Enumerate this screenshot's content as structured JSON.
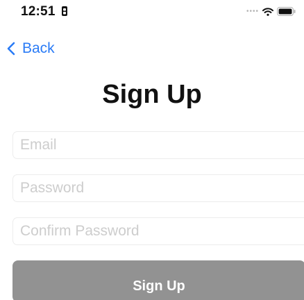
{
  "status_bar": {
    "time": "12:51",
    "icons": [
      "more-dots-icon",
      "wifi-icon",
      "battery-icon"
    ]
  },
  "nav": {
    "back_label": "Back",
    "back_icon": "chevron-left-icon",
    "accent_color": "#2a7bf6"
  },
  "page": {
    "title": "Sign Up"
  },
  "form": {
    "email": {
      "value": "",
      "placeholder": "Email"
    },
    "password": {
      "value": "",
      "placeholder": "Password"
    },
    "confirm_password": {
      "value": "",
      "placeholder": "Confirm Password"
    },
    "submit_label": "Sign Up",
    "submit_color": "#929292"
  }
}
